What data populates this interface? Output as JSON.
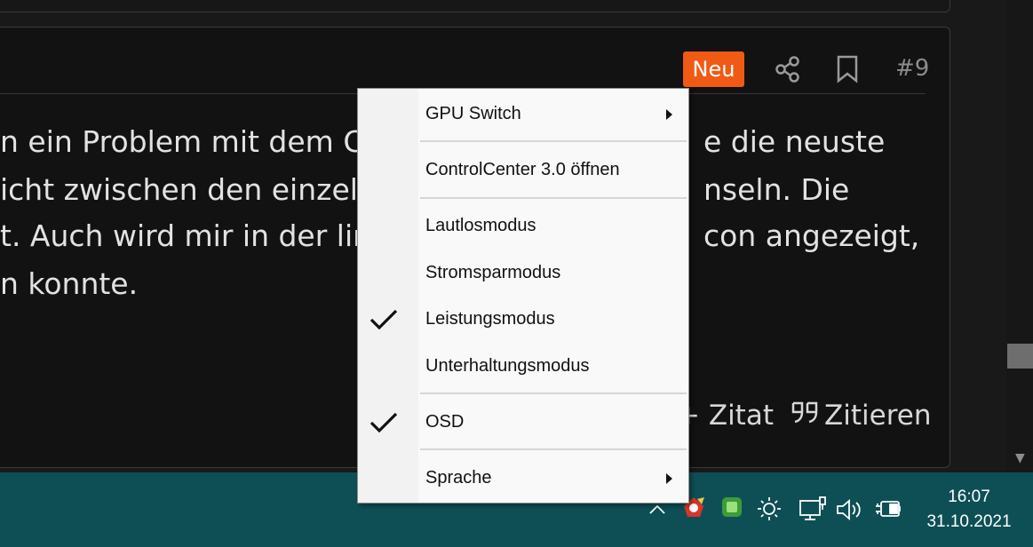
{
  "post": {
    "badge": "Neu",
    "number": "#9",
    "lines": [
      "n ein Problem mit dem C",
      "icht zwischen den einzelr",
      "t. Auch wird mir in der lir",
      "n konnte."
    ],
    "lines_right": [
      "e die neuste",
      "nseln. Die",
      "con angezeigt,"
    ],
    "actions": {
      "zitat": "+ Zitat",
      "zitieren": "Zitieren"
    }
  },
  "context_menu": {
    "items": [
      {
        "label": "GPU Switch",
        "submenu": true,
        "checked": false
      },
      {
        "label": "ControlCenter 3.0 öffnen",
        "submenu": false,
        "checked": false
      },
      {
        "label": "Lautlosmodus",
        "submenu": false,
        "checked": false
      },
      {
        "label": "Stromsparmodus",
        "submenu": false,
        "checked": false
      },
      {
        "label": "Leistungsmodus",
        "submenu": false,
        "checked": true
      },
      {
        "label": "Unterhaltungsmodus",
        "submenu": false,
        "checked": false
      },
      {
        "label": "OSD",
        "submenu": false,
        "checked": true
      },
      {
        "label": "Sprache",
        "submenu": true,
        "checked": false
      }
    ]
  },
  "taskbar": {
    "time": "16:07",
    "date": "31.10.2021",
    "tray_icons": [
      "chevron-up-icon",
      "control-center-icon",
      "green-app-icon",
      "brightness-icon",
      "network-icon",
      "volume-icon",
      "battery-charging-icon"
    ]
  },
  "colors": {
    "accent": "#f05a14",
    "taskbar": "#0e4f56",
    "background": "#121212"
  }
}
